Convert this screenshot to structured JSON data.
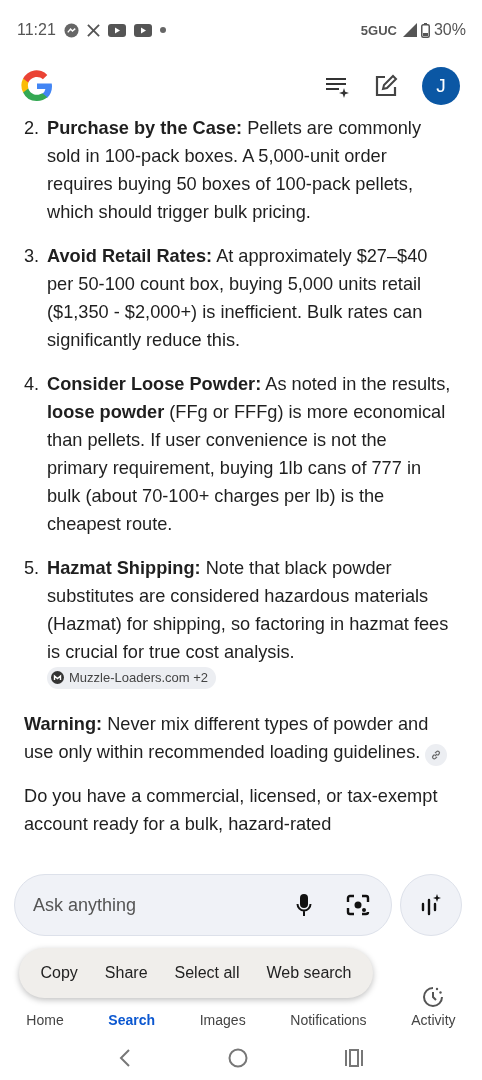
{
  "status_bar": {
    "time": "11:21",
    "network": "5GUC",
    "battery": "30%"
  },
  "header": {
    "avatar": "J"
  },
  "answer": {
    "list": [
      {
        "number": "2.",
        "text": "**Purchase by the Case:** Pellets are commonly sold in 100-pack boxes. A 5,000-unit order requires buying 50 boxes of 100-pack pellets, which should trigger bulk pricing."
      },
      {
        "number": "3.",
        "text": "**Avoid Retail Rates:** At approximately $27–$40 per 50-100 count box, buying 5,000 units retail ($1,350 - $2,000+) is inefficient. Bulk rates can significantly reduce this."
      },
      {
        "number": "4.",
        "text": "**Consider Loose Powder:** As noted in the results, **loose powder** (FFg or FFFg) is more economical than pellets. If user convenience is not the primary requirement, buying 1lb cans of 777 in bulk (about 70-100+ charges per lb) is the cheapest route."
      },
      {
        "number": "5.",
        "text": "**Hazmat Shipping:** Note that black powder substitutes are considered hazardous materials (Hazmat) for shipping, so factoring in hazmat fees is crucial for true cost analysis.",
        "source": "Muzzle-Loaders.com +2"
      }
    ],
    "warning": "**Warning:** Never mix different types of powder and use only within recommended loading guidelines.",
    "question": "Do you have a commercial, licensed, or tax-exempt account ready for a bulk, hazard-rated"
  },
  "ask_bar": {
    "placeholder": "Ask anything"
  },
  "nav": [
    {
      "label": "Home",
      "selected": false
    },
    {
      "label": "Search",
      "selected": true
    },
    {
      "label": "Images",
      "selected": false
    },
    {
      "label": "Notifications",
      "selected": false
    },
    {
      "label": "Activity",
      "selected": false
    }
  ],
  "text_menu": [
    "Copy",
    "Share",
    "Select all",
    "Web search"
  ]
}
